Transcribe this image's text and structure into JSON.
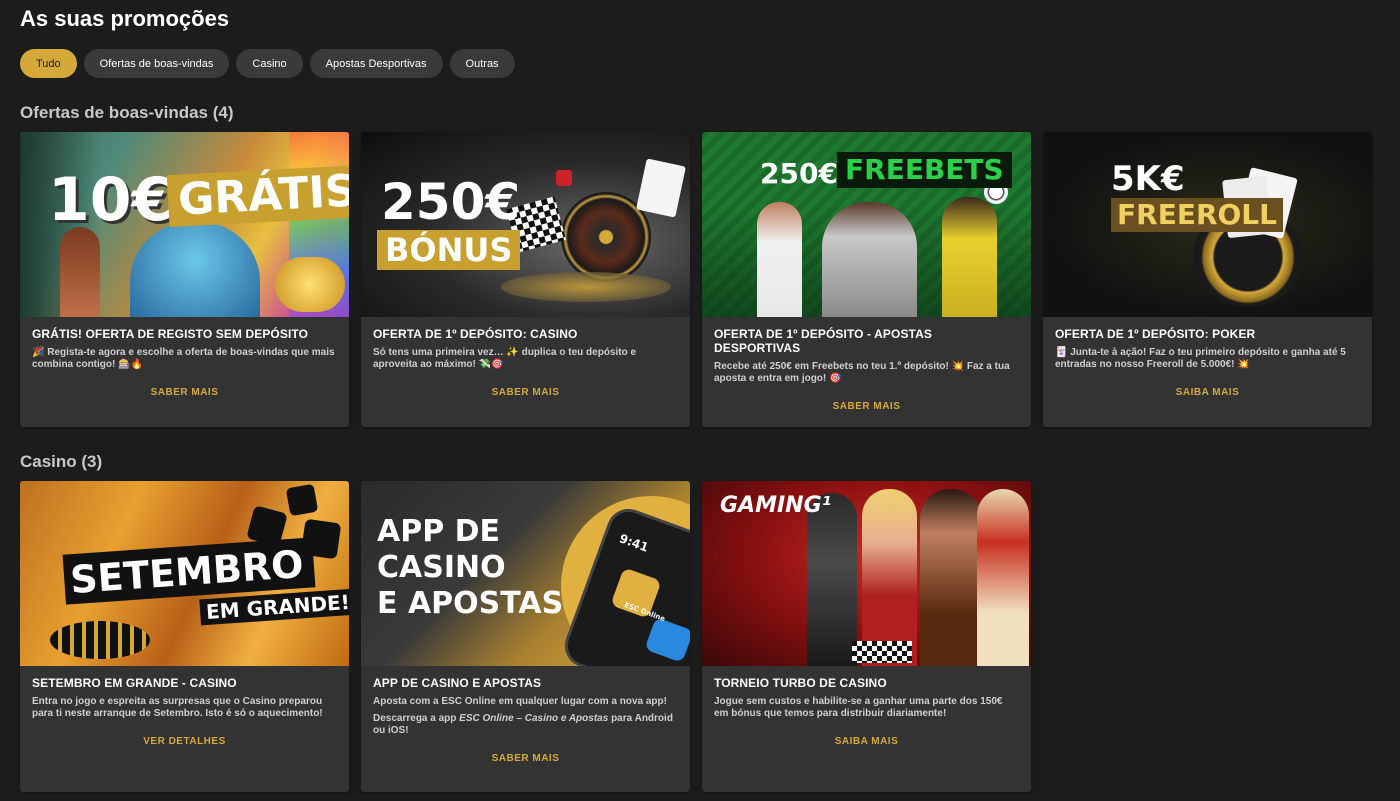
{
  "page": {
    "title": "As suas promoções"
  },
  "filters": [
    {
      "label": "Tudo",
      "active": true
    },
    {
      "label": "Ofertas de boas-vindas",
      "active": false
    },
    {
      "label": "Casino",
      "active": false
    },
    {
      "label": "Apostas Desportivas",
      "active": false
    },
    {
      "label": "Outras",
      "active": false
    }
  ],
  "sections": [
    {
      "title": "Ofertas de boas-vindas (4)",
      "cards": [
        {
          "banner": {
            "line1": "10€",
            "line2": "GRÁTIS"
          },
          "title": "GRÁTIS! OFERTA DE REGISTO SEM DEPÓSITO",
          "text": "🎉 Regista-te agora e escolhe a oferta de boas-vindas que mais combina contigo! 🎰🔥",
          "cta": "SABER MAIS"
        },
        {
          "banner": {
            "line1": "250€",
            "line2": "BÓNUS"
          },
          "title": "OFERTA DE 1º DEPÓSITO: CASINO",
          "text": "Só tens uma primeira vez… ✨ duplica o teu depósito e aproveita ao máximo! 💸🎯",
          "cta": "SABER MAIS"
        },
        {
          "banner": {
            "line1": "250€",
            "line2": "FREEBETS"
          },
          "title": "OFERTA DE 1º DEPÓSITO - APOSTAS DESPORTIVAS",
          "text": "Recebe até 250€ em Freebets no teu 1.º depósito! 💥 Faz a tua aposta e entra em jogo! 🎯",
          "cta": "SABER MAIS"
        },
        {
          "banner": {
            "line1": "5K€",
            "line2": "FREEROLL"
          },
          "title": "OFERTA DE 1º DEPÓSITO: POKER",
          "text": "🃏 Junta-te à ação! Faz o teu primeiro depósito e ganha até 5 entradas no nosso Freeroll de 5.000€! 💥",
          "cta": "SAIBA MAIS"
        }
      ]
    },
    {
      "title": "Casino (3)",
      "cards": [
        {
          "banner": {
            "line1": "SETEMBRO",
            "line2": "EM GRANDE!"
          },
          "title": "SETEMBRO EM GRANDE - CASINO",
          "text": "Entra no jogo e espreita as surpresas que o Casino preparou para ti neste arranque de Setembro. Isto é só o aquecimento!",
          "cta": "VER DETALHES"
        },
        {
          "banner": {
            "line1": "APP DE",
            "line2": "CASINO",
            "line3": "E APOSTAS",
            "phone_time": "9:41",
            "phone_app": "ESC Online"
          },
          "title": "APP DE CASINO E APOSTAS",
          "text": "Aposta com a ESC Online em qualquer lugar com a nova app!",
          "text2_prefix": "Descarrega a app ",
          "text2_em": "ESC Online – Casino e Apostas",
          "text2_suffix": " para Android ou iOS!",
          "cta": "SABER MAIS"
        },
        {
          "banner": {
            "line1": "GAMING¹"
          },
          "title": "TORNEIO TURBO DE CASINO",
          "text": "Jogue sem custos e habilite-se a ganhar uma parte dos 150€ em bónus que temos para distribuir diariamente!",
          "cta": "SAIBA MAIS"
        }
      ]
    }
  ],
  "colors": {
    "accent": "#d4a93a",
    "background": "#1c1c1c",
    "card": "#333333",
    "chip": "#3a3a3a"
  }
}
